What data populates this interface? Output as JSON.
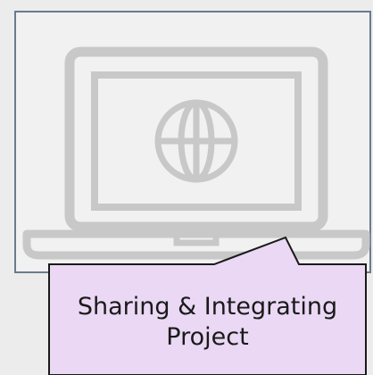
{
  "callout": {
    "label": "Sharing & Integrating\nProject"
  },
  "icons": {
    "main": "laptop-globe-icon"
  },
  "colors": {
    "frame_border": "#6b7b8c",
    "icon_stroke": "#c8c8c8",
    "callout_fill": "#ead8f4",
    "callout_border": "#1a1a1a"
  }
}
